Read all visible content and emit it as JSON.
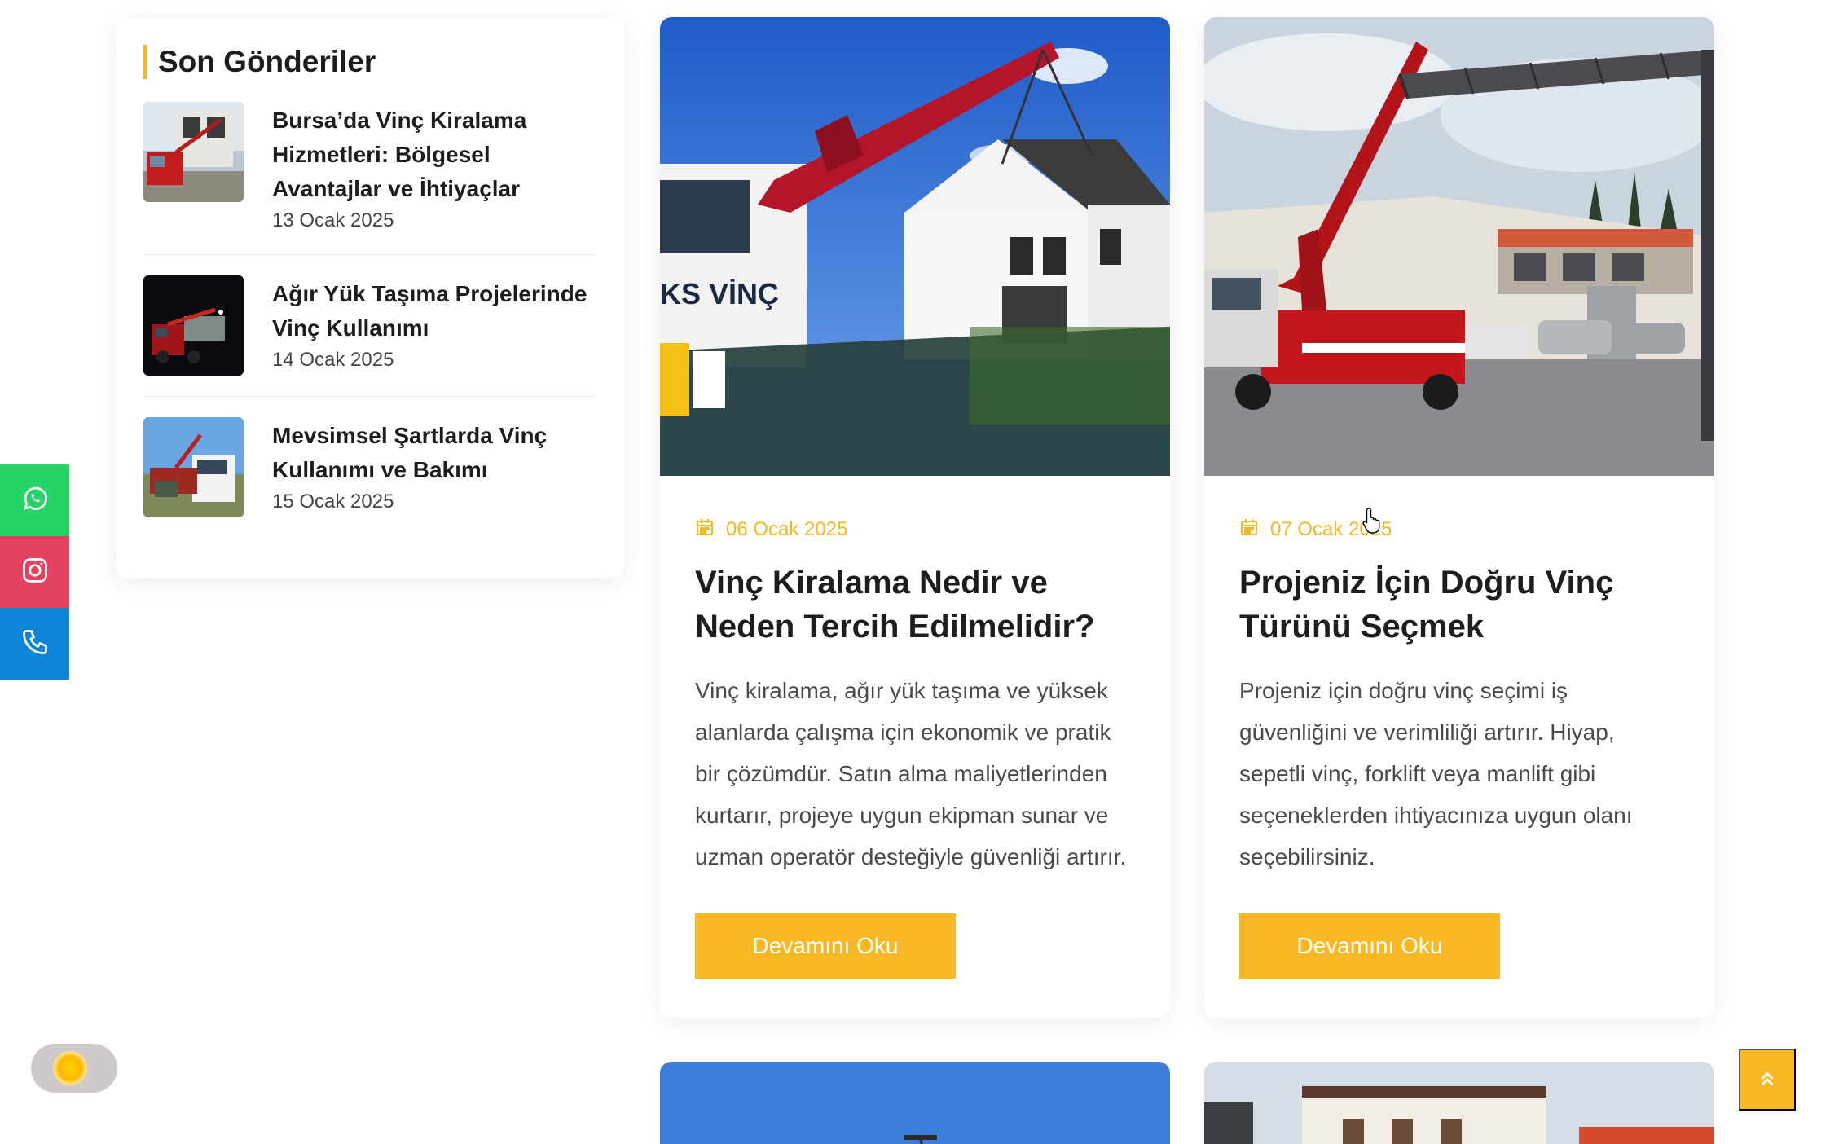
{
  "sidebar": {
    "title": "Son Gönderiler",
    "posts": [
      {
        "title": "Bursa’da Vinç Kiralama Hizmetleri: Bölgesel Avantajlar ve İhtiyaçlar",
        "date": "13 Ocak 2025"
      },
      {
        "title": "Ağır Yük Taşıma Projelerinde Vinç Kullanımı",
        "date": "14 Ocak 2025"
      },
      {
        "title": "Mevsimsel Şartlarda Vinç Kullanımı ve Bakımı",
        "date": "15 Ocak 2025"
      }
    ]
  },
  "cards": [
    {
      "date": "06 Ocak 2025",
      "title": "Vinç Kiralama Nedir ve Neden Tercih Edilmelidir?",
      "excerpt": "Vinç kiralama, ağır yük taşıma ve yüksek alanlarda çalışma için ekonomik ve pratik bir çözümdür. Satın alma maliyetlerinden kurtarır, projeye uygun ekipman sunar ve uzman operatör desteğiyle güvenliği artırır.",
      "button": "Devamını Oku"
    },
    {
      "date": "07 Ocak 2025",
      "title": "Projeniz İçin Doğru Vinç Türünü Seçmek",
      "excerpt": "Projeniz için doğru vinç seçimi iş güvenliğini ve verimliliği artırır. Hiyap, sepetli vinç, forklift veya manlift gibi seçeneklerden ihtiyacınıza uygun olanı seçebilirsiniz.",
      "button": "Devamını Oku"
    }
  ],
  "social": [
    "whatsapp-icon",
    "instagram-icon",
    "phone-icon"
  ],
  "colors": {
    "accent": "#f7b823",
    "whatsapp": "#25d366",
    "instagram": "#e4405f",
    "phone": "#0d86d7"
  }
}
